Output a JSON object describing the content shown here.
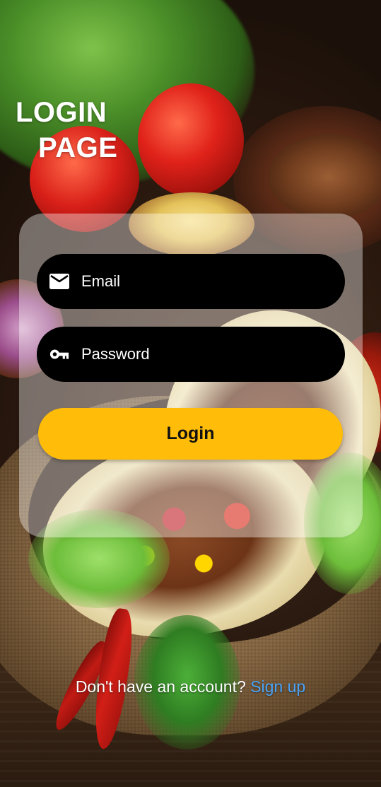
{
  "title": {
    "line1": "LOGIN",
    "line2": "PAGE"
  },
  "form": {
    "email": {
      "placeholder": "Email",
      "value": "",
      "icon": "mail-icon"
    },
    "password": {
      "placeholder": "Password",
      "value": "",
      "icon": "key-icon"
    },
    "login_label": "Login"
  },
  "footer": {
    "prompt": "Don't have an account?",
    "signup_label": "Sign up"
  },
  "colors": {
    "accent": "#ffbd0a",
    "field_bg": "#000000",
    "link": "#4aa3f7",
    "card_overlay": "rgba(255,255,255,0.38)"
  }
}
